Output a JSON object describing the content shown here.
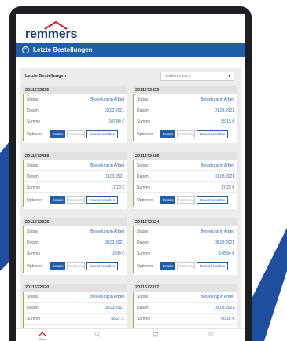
{
  "app": {
    "logo_text": "remmers"
  },
  "header": {
    "title": "Letzte Bestellungen"
  },
  "section": {
    "title": "Letzte Bestellungen",
    "sort_label": "Sortieren nach"
  },
  "labels": {
    "status": "Status",
    "date": "Datum",
    "sum": "Summe",
    "options": "Optionen",
    "details": "Details",
    "invoice": "Rechnung",
    "reorder": "Erneut bestellen"
  },
  "orders": [
    {
      "number": "2011672835",
      "status": "Bestellung in Arbeit",
      "date": "02.03.2021",
      "total": "107,80 €"
    },
    {
      "number": "2011672423",
      "status": "Bestellung in Arbeit",
      "date": "01.03.2021",
      "total": "85,15 €"
    },
    {
      "number": "2011672418",
      "status": "Bestellung in Arbeit",
      "date": "01.03.2021",
      "total": "17,23 €"
    },
    {
      "number": "2011672415",
      "status": "Bestellung in Arbeit",
      "date": "01.03.2021",
      "total": "17,23 €"
    },
    {
      "number": "2011672325",
      "status": "Bestellung in Arbeit",
      "date": "09.03.2021",
      "total": "16,99 €"
    },
    {
      "number": "2011672324",
      "status": "Bestellung in Arbeit",
      "date": "09.03.2021",
      "total": "148,94 €"
    },
    {
      "number": "2011672320",
      "status": "Bestellung in Arbeit",
      "date": "09.03.2021",
      "total": "66,21 €"
    },
    {
      "number": "2011672317",
      "status": "Bestellung in Arbeit",
      "date": "03.03.2021",
      "total": "60,15 €"
    }
  ],
  "nav": [
    {
      "icon": "home-icon",
      "label": "Start"
    },
    {
      "icon": "search-icon"
    },
    {
      "icon": "cart-icon"
    },
    {
      "icon": "menu-icon"
    }
  ],
  "colors": {
    "brand_blue": "#1f5fa9",
    "logo_blue": "#1c3d7d",
    "accent_red": "#d41f26",
    "status_green": "#7dc142",
    "background_blue": "#1d4f9e"
  }
}
